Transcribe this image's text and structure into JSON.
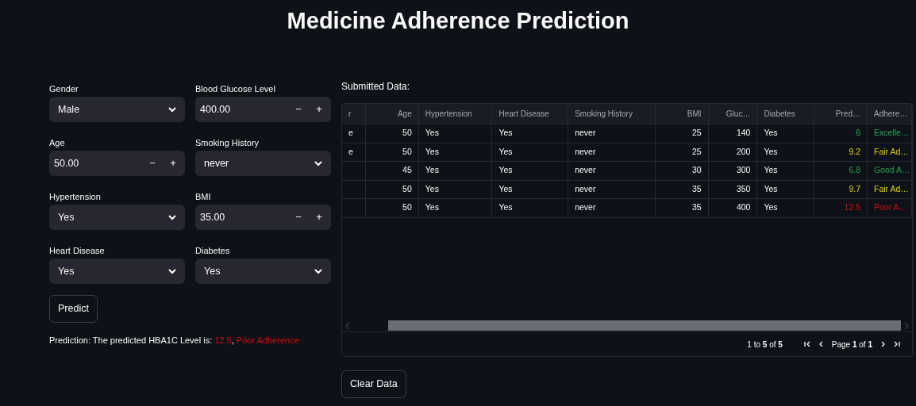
{
  "title": "Medicine Adherence Prediction",
  "form": {
    "left": [
      {
        "kind": "select",
        "label": "Gender",
        "value": "Male"
      },
      {
        "kind": "number",
        "label": "Age",
        "value": "50.00",
        "minus": "−",
        "plus": "+"
      },
      {
        "kind": "select",
        "label": "Hypertension",
        "value": "Yes"
      },
      {
        "kind": "select",
        "label": "Heart Disease",
        "value": "Yes"
      }
    ],
    "right": [
      {
        "kind": "number",
        "label": "Blood Glucose Level",
        "value": "400.00",
        "minus": "−",
        "plus": "+"
      },
      {
        "kind": "select",
        "label": "Smoking History",
        "value": "never"
      },
      {
        "kind": "number",
        "label": "BMI",
        "value": "35.00",
        "minus": "−",
        "plus": "+"
      },
      {
        "kind": "select",
        "label": "Diabetes",
        "value": "Yes"
      }
    ]
  },
  "predict_button": "Predict",
  "prediction": {
    "text": "Prediction: The predicted HBA1C Level is:",
    "value": "12.5",
    "separator": ",",
    "adherence": "Poor Adherence",
    "kind": "poor"
  },
  "submitted_label": "Submitted Data:",
  "table": {
    "columns": [
      "r",
      "Age",
      "Hypertension",
      "Heart Disease",
      "Smoking History",
      "BMI",
      "Gluc…",
      "Diabetes",
      "Pred…",
      "Adhere…"
    ],
    "rows": [
      {
        "cells": [
          "e",
          "50",
          "Yes",
          "Yes",
          "never",
          "25",
          "140",
          "Yes",
          "6",
          "Excelle…"
        ],
        "kind": "excellent"
      },
      {
        "cells": [
          "e",
          "50",
          "Yes",
          "Yes",
          "never",
          "25",
          "200",
          "Yes",
          "9.2",
          "Fair Ad…"
        ],
        "kind": "fair"
      },
      {
        "cells": [
          null,
          "45",
          "Yes",
          "Yes",
          "never",
          "30",
          "300",
          "Yes",
          "6.8",
          "Good A…"
        ],
        "kind": "good"
      },
      {
        "cells": [
          null,
          "50",
          "Yes",
          "Yes",
          "never",
          "35",
          "350",
          "Yes",
          "9.7",
          "Fair Ad…"
        ],
        "kind": "fair"
      },
      {
        "cells": [
          null,
          "50",
          "Yes",
          "Yes",
          "never",
          "35",
          "400",
          "Yes",
          "12.5",
          "Poor A…"
        ],
        "kind": "poor"
      }
    ],
    "row_count": "1 to **5** of **5**",
    "page": "Page **1** of **1**"
  },
  "clear_button": "Clear Data"
}
